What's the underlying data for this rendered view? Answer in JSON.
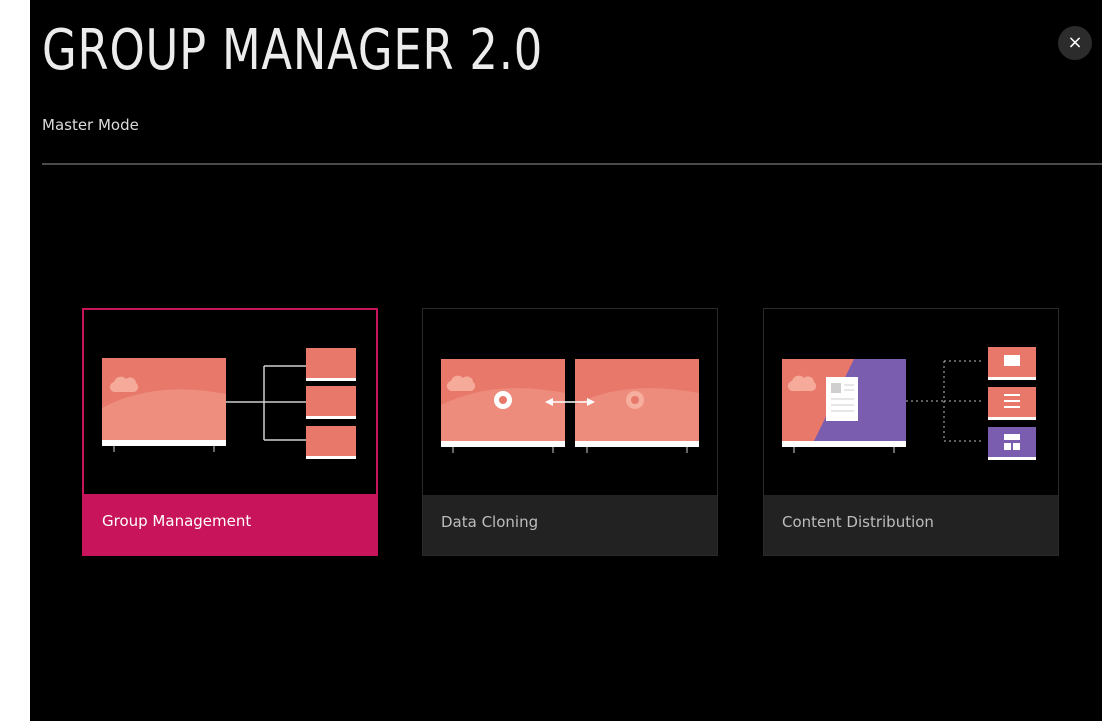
{
  "header": {
    "title": "GROUP MANAGER 2.0",
    "subtitle": "Master Mode",
    "close_glyph": "×"
  },
  "cards": [
    {
      "label": "Group Management",
      "selected": true,
      "icon": "group-management-icon"
    },
    {
      "label": "Data Cloning",
      "selected": false,
      "icon": "data-cloning-icon"
    },
    {
      "label": "Content Distribution",
      "selected": false,
      "icon": "content-distribution-icon"
    }
  ],
  "colors": {
    "background": "#000000",
    "accent": "#c8145a",
    "card_label_bg": "#222222",
    "screen_salmon": "#e8786a",
    "screen_light": "#f2a08e",
    "purple": "#7b5db0"
  }
}
